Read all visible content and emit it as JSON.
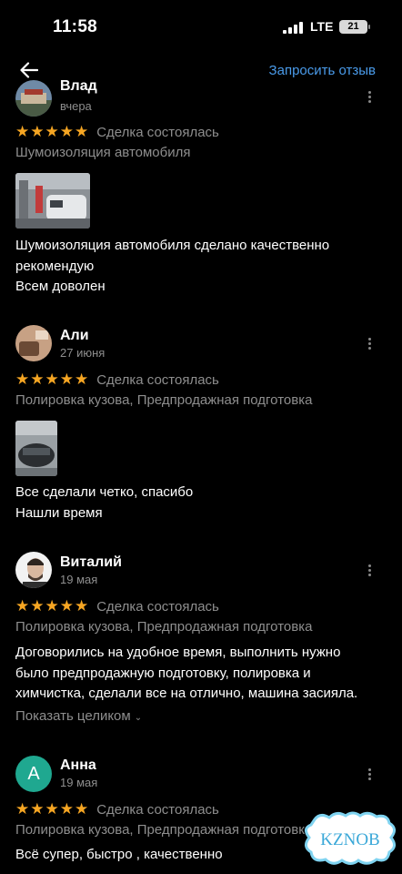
{
  "status_bar": {
    "time": "11:58",
    "network": "LTE",
    "battery": "21"
  },
  "header": {
    "request_review": "Запросить отзыв"
  },
  "reviews": [
    {
      "name": "Влад",
      "date": "вчера",
      "stars": "★★★★★",
      "deal": "Сделка состоялась",
      "services": "Шумоизоляция автомобиля",
      "text": [
        "Шумоизоляция автомобиля сделано качественно",
        "рекомендую",
        "Всем доволен"
      ]
    },
    {
      "name": "Али",
      "date": "27 июня",
      "stars": "★★★★★",
      "deal": "Сделка состоялась",
      "services": "Полировка кузова, Предпродажная подготовка",
      "text": [
        "Все сделали четко, спасибо",
        "Нашли время"
      ]
    },
    {
      "name": "Виталий",
      "date": "19 мая",
      "stars": "★★★★★",
      "deal": "Сделка состоялась",
      "services": "Полировка кузова, Предпродажная подготовка",
      "text": [
        "Договорились на удобное время, выполнить нужно",
        "было предпродажную подготовку, полировка и",
        "химчистка, сделали все на отлично, машина засияла."
      ],
      "show_more": "Показать целиком"
    },
    {
      "name": "Анна",
      "date": "19 мая",
      "avatar_letter": "А",
      "stars": "★★★★★",
      "deal": "Сделка состоялась",
      "services": "Полировка кузова, Предпродажная подготовка",
      "text": [
        "Всё супер, быстро , качественно"
      ]
    }
  ],
  "watermark": "KZNOB",
  "colors": {
    "accent_blue": "#4a9bea",
    "star": "#f6a623",
    "avatar_green": "#1fa890"
  }
}
